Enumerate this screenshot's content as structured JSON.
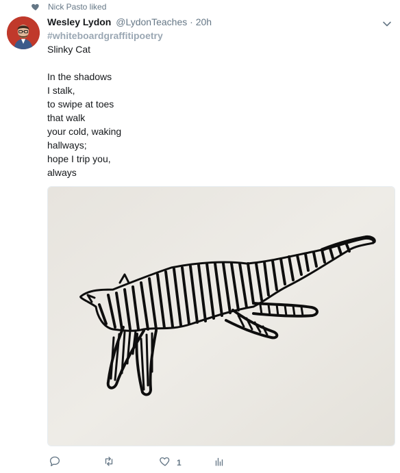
{
  "social_context": {
    "text": "Nick Pasto liked",
    "icon": "heart-icon"
  },
  "tweet": {
    "author_name": "Wesley Lydon",
    "author_handle": "@LydonTeaches",
    "separator": "·",
    "timestamp": "20h",
    "hashtag": "#whiteboardgraffitipoetry",
    "lines": [
      "Slinky Cat",
      "",
      "In the shadows",
      "I stalk,",
      "to swipe at toes",
      "that walk",
      "your cold, waking",
      "hallways;",
      "hope I trip you,",
      "always"
    ],
    "media": {
      "alt_subject": "whiteboard drawing of a leaping cat"
    }
  },
  "actions": {
    "reply": {
      "icon": "reply-icon"
    },
    "retweet": {
      "icon": "retweet-icon"
    },
    "like": {
      "icon": "like-icon",
      "count": "1"
    },
    "analytics": {
      "icon": "analytics-icon"
    }
  },
  "colors": {
    "text_primary": "#14171a",
    "text_secondary": "#657786",
    "hashtag": "#9aa7b3"
  }
}
